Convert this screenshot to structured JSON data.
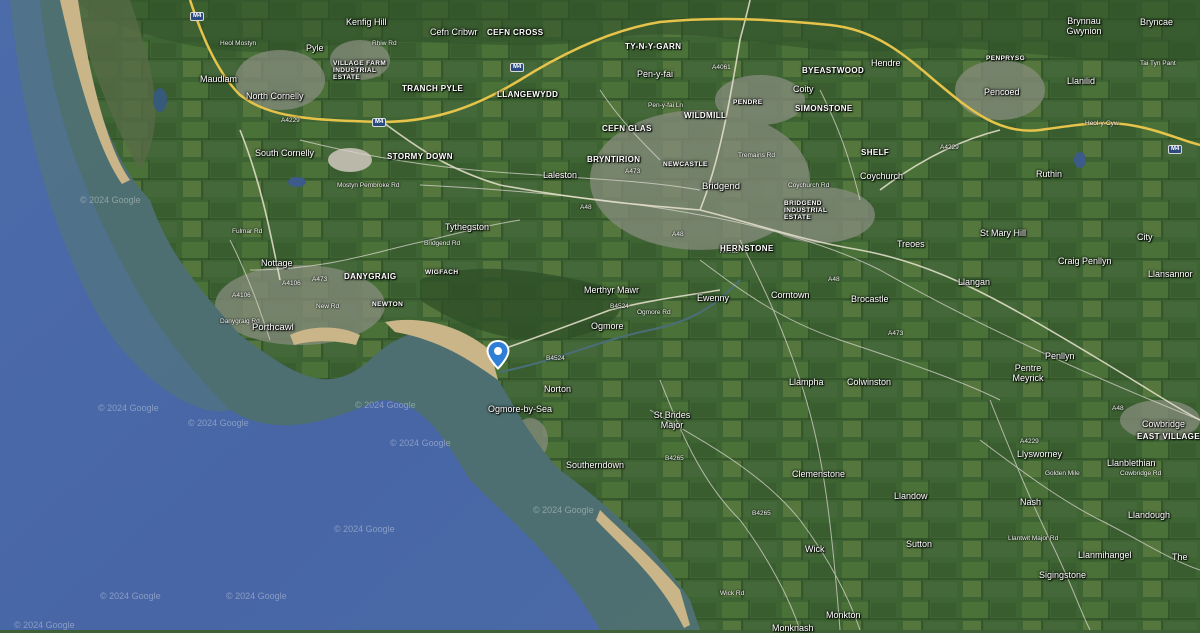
{
  "map": {
    "colors": {
      "sea": "#4a68a8",
      "shallow_sea": "#4f7068",
      "land": "#3f6534",
      "beach": "#cbb78b",
      "motorway": "#e6c34a",
      "urban": "#8a8f82",
      "marker": "#2f7fd6"
    },
    "marker": {
      "icon": "location-pin-icon"
    },
    "watermarks": [
      "© 2024 Google",
      "© 2024 Google",
      "© 2024 Google",
      "© 2024 Google",
      "© 2024 Google",
      "© 2024 Google",
      "© 2024 Google",
      "© 2024 Google",
      "© 2024 Google",
      "© 2024 Google"
    ],
    "places": [
      "Kenfig Hill",
      "Cefn Cribwr",
      "CEFN CROSS",
      "Pyle",
      "VILLAGE FARM INDUSTRIAL ESTATE",
      "Maudlam",
      "TRANCH PYLE",
      "LLANGEWYDD",
      "North Cornelly",
      "South Cornelly",
      "STORMY DOWN",
      "Laleston",
      "Tythegston",
      "Nottage",
      "DANYGRAIG",
      "WIGFACH",
      "NEWTON",
      "Porthcawl",
      "Merthyr Mawr",
      "Ogmore",
      "Norton",
      "Ogmore-by-Sea",
      "St Brides Major",
      "Southerndown",
      "TY-N-Y-GARN",
      "Pen-y-fai",
      "CEFN GLAS",
      "WILDMILL",
      "BRYNTIRION",
      "NEWCASTLE",
      "Bridgend",
      "BRIDGEND INDUSTRIAL ESTATE",
      "HERNSTONE",
      "Ewenny",
      "Corntown",
      "Brocastle",
      "Llampha",
      "Colwinston",
      "Clemenstone",
      "Wick",
      "Monkton",
      "Monknash",
      "BYEASTWOOD",
      "Coity",
      "PENDRE",
      "SIMONSTONE",
      "SHELF",
      "Coychurch",
      "Treoes",
      "Hendre",
      "Pencoed",
      "PENPRYSG",
      "Brynnau Gwynion",
      "Bryncae",
      "Llanilid",
      "Ruthin",
      "St Mary Hill",
      "City",
      "Craig Penllyn",
      "Llangan",
      "Llansannor",
      "Penllyn",
      "Pentre Meyrick",
      "Cowbridge",
      "EAST VILLAGE",
      "Llysworney",
      "Llanblethian",
      "Nash",
      "Llandow",
      "Llandough",
      "Sutton",
      "Llanmihangel",
      "Sigingstone",
      "The"
    ],
    "road_labels": [
      "M4",
      "M4",
      "M4",
      "M4",
      "A48",
      "A48",
      "A48",
      "A48",
      "A4061",
      "A473",
      "A4063",
      "A473",
      "A4229",
      "A4106",
      "A4106",
      "A4229",
      "B4524",
      "B4265",
      "B4265",
      "B4524",
      "A473",
      "A4229",
      "Heol Mostyn",
      "Mostyn Pembroke Rd",
      "Fulmar Rd",
      "Bridgend Rd",
      "New Rd",
      "Danygraig Rd",
      "Ogmore Rd",
      "Rhiw Rd",
      "Coychurch Rd",
      "Wick Rd",
      "Heol-y-Cyw",
      "Llantwit Major Rd",
      "Golden Mile",
      "Tai Tyn Pant",
      "Pen-y-fai Ln",
      "Tremains Rd",
      "Cowbridge Rd"
    ]
  }
}
